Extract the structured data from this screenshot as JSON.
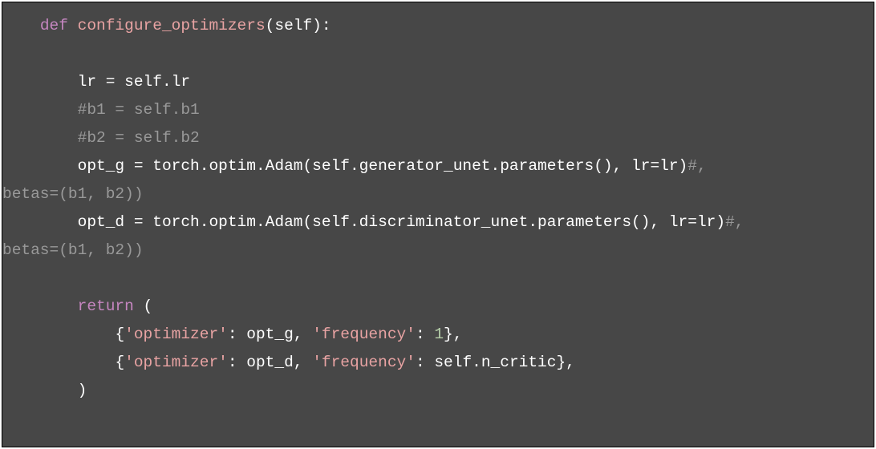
{
  "code": {
    "l01": {
      "indent": "    ",
      "kw": "def",
      "space": " ",
      "fn": "configure_optimizers",
      "params": "(self):"
    },
    "l02": "",
    "l03": {
      "indent": "        ",
      "text": "lr = self.lr"
    },
    "l04": {
      "indent": "        ",
      "cmt": "#b1 = self.b1"
    },
    "l05": {
      "indent": "        ",
      "cmt": "#b2 = self.b2"
    },
    "l06": {
      "indent": "        ",
      "text": "opt_g = torch.optim.Adam(self.generator_unet.parameters(), lr=lr)",
      "cmt": "#, "
    },
    "l07": {
      "cmt": "betas=(b1, b2))"
    },
    "l08": {
      "indent": "        ",
      "text": "opt_d = torch.optim.Adam(self.discriminator_unet.parameters(), lr=lr)",
      "cmt": "#, "
    },
    "l09": {
      "cmt": "betas=(b1, b2))"
    },
    "l10": "",
    "l11": {
      "indent": "        ",
      "kw": "return",
      "text": " ("
    },
    "l12": {
      "indent": "            ",
      "p1": "{",
      "k1": "'optimizer'",
      "p2": ": opt_g, ",
      "k2": "'frequency'",
      "p3": ": ",
      "num": "1",
      "p4": "},"
    },
    "l13": {
      "indent": "            ",
      "p1": "{",
      "k1": "'optimizer'",
      "p2": ": opt_d, ",
      "k2": "'frequency'",
      "p3": ": self.n_critic},"
    },
    "l14": {
      "indent": "        ",
      "text": ")"
    }
  }
}
